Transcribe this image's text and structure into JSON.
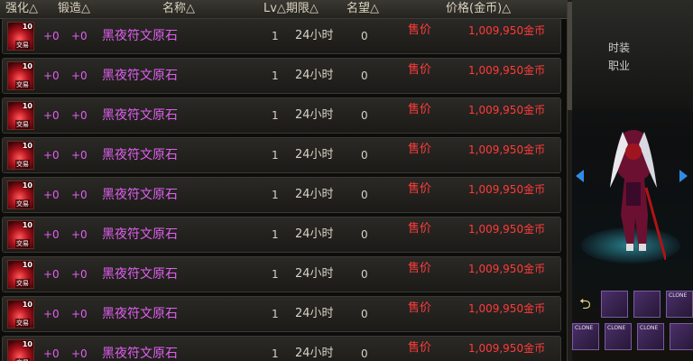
{
  "header": {
    "enhance": "强化△",
    "forge": "锻造△",
    "name": "名称△",
    "lv_period": "Lv△期限△",
    "fame": "名望△",
    "price": "价格(金币)△"
  },
  "rows": [
    {
      "level_badge": "10",
      "trade": "交易",
      "enhance": "+0",
      "forge": "+0",
      "name": "黑夜符文原石",
      "lv": "1",
      "period": "24小时",
      "fame": "0",
      "sell": "售价",
      "price": "1,009,950金币"
    },
    {
      "level_badge": "10",
      "trade": "交易",
      "enhance": "+0",
      "forge": "+0",
      "name": "黑夜符文原石",
      "lv": "1",
      "period": "24小时",
      "fame": "0",
      "sell": "售价",
      "price": "1,009,950金币"
    },
    {
      "level_badge": "10",
      "trade": "交易",
      "enhance": "+0",
      "forge": "+0",
      "name": "黑夜符文原石",
      "lv": "1",
      "period": "24小时",
      "fame": "0",
      "sell": "售价",
      "price": "1,009,950金币"
    },
    {
      "level_badge": "10",
      "trade": "交易",
      "enhance": "+0",
      "forge": "+0",
      "name": "黑夜符文原石",
      "lv": "1",
      "period": "24小时",
      "fame": "0",
      "sell": "售价",
      "price": "1,009,950金币"
    },
    {
      "level_badge": "10",
      "trade": "交易",
      "enhance": "+0",
      "forge": "+0",
      "name": "黑夜符文原石",
      "lv": "1",
      "period": "24小时",
      "fame": "0",
      "sell": "售价",
      "price": "1,009,950金币"
    },
    {
      "level_badge": "10",
      "trade": "交易",
      "enhance": "+0",
      "forge": "+0",
      "name": "黑夜符文原石",
      "lv": "1",
      "period": "24小时",
      "fame": "0",
      "sell": "售价",
      "price": "1,009,950金币"
    },
    {
      "level_badge": "10",
      "trade": "交易",
      "enhance": "+0",
      "forge": "+0",
      "name": "黑夜符文原石",
      "lv": "1",
      "period": "24小时",
      "fame": "0",
      "sell": "售价",
      "price": "1,009,950金币"
    },
    {
      "level_badge": "10",
      "trade": "交易",
      "enhance": "+0",
      "forge": "+0",
      "name": "黑夜符文原石",
      "lv": "1",
      "period": "24小时",
      "fame": "0",
      "sell": "售价",
      "price": "1,009,950金币"
    },
    {
      "level_badge": "10",
      "trade": "交易",
      "enhance": "+0",
      "forge": "+0",
      "name": "黑夜符文原石",
      "lv": "1",
      "period": "24小时",
      "fame": "0",
      "sell": "售价",
      "price": "1,009,950金币"
    }
  ],
  "side": {
    "labels": [
      "时装",
      "职业"
    ],
    "clone_tag": "CLONE"
  },
  "colors": {
    "item_name": "#e060f0",
    "price": "#ff3b3b",
    "header_text": "#d9d2bf"
  }
}
